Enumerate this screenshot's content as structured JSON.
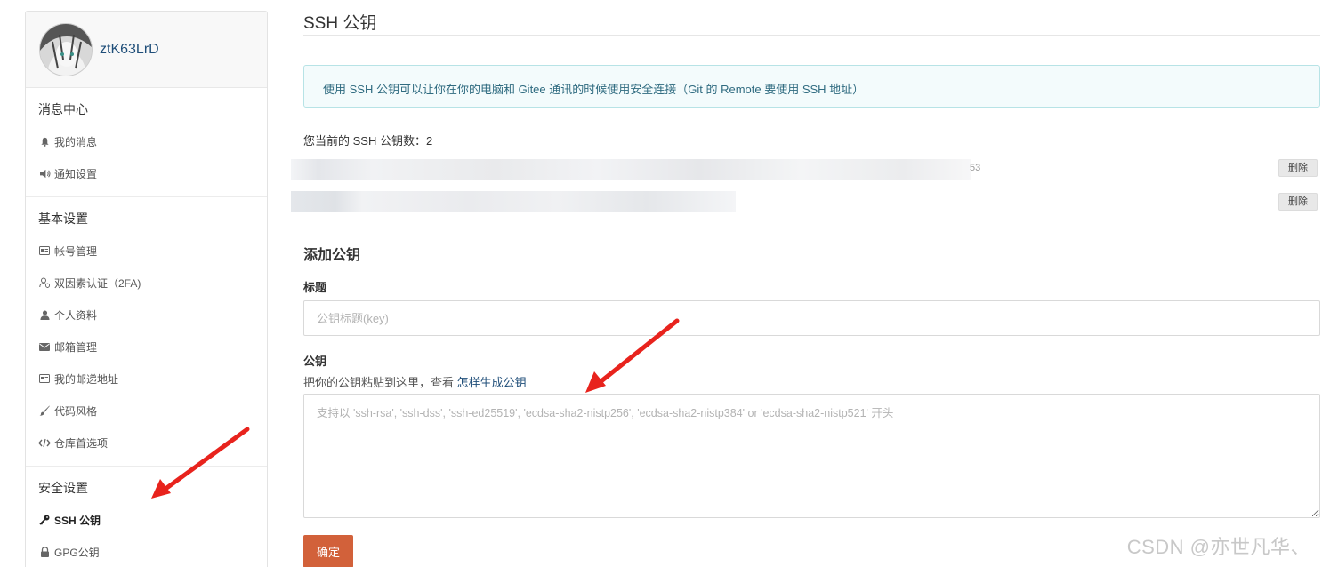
{
  "sidebar": {
    "username": "ztK63LrD",
    "sections": [
      {
        "title": "消息中心",
        "items": [
          {
            "label": "我的消息",
            "icon": "bell-icon"
          },
          {
            "label": "通知设置",
            "icon": "speaker-icon"
          }
        ]
      },
      {
        "title": "基本设置",
        "items": [
          {
            "label": "帐号管理",
            "icon": "id-card-icon"
          },
          {
            "label": "双因素认证（2FA)",
            "icon": "user-shield-icon"
          },
          {
            "label": "个人资料",
            "icon": "user-icon"
          },
          {
            "label": "邮箱管理",
            "icon": "envelope-icon"
          },
          {
            "label": "我的邮递地址",
            "icon": "address-card-icon"
          },
          {
            "label": "代码风格",
            "icon": "brush-icon"
          },
          {
            "label": "仓库首选项",
            "icon": "code-icon"
          }
        ]
      },
      {
        "title": "安全设置",
        "items": [
          {
            "label": "SSH 公钥",
            "icon": "key-icon",
            "active": true
          },
          {
            "label": "GPG公钥",
            "icon": "lock-icon"
          }
        ]
      }
    ]
  },
  "main": {
    "title": "SSH 公钥",
    "info": "使用 SSH 公钥可以让你在你的电脑和 Gitee 通讯的时候使用安全连接（Git 的 Remote 要使用 SSH 地址）",
    "count_label": "您当前的 SSH 公钥数：",
    "count_value": "2",
    "keys": [
      {
        "suffix": "53",
        "delete_label": "删除"
      },
      {
        "suffix": "",
        "delete_label": "删除"
      }
    ],
    "add_title": "添加公钥",
    "title_label": "标题",
    "title_placeholder": "公钥标题(key)",
    "key_label": "公钥",
    "key_hint": "把你的公钥粘贴到这里，查看 ",
    "key_hint_link": "怎样生成公钥",
    "key_placeholder": "支持以 'ssh-rsa', 'ssh-dss', 'ssh-ed25519', 'ecdsa-sha2-nistp256', 'ecdsa-sha2-nistp384' or 'ecdsa-sha2-nistp521' 开头",
    "confirm_label": "确定"
  },
  "watermark": "CSDN @亦世凡华、",
  "colors": {
    "accent": "#d2613a",
    "arrow": "#e8231d",
    "link": "#1f4e79",
    "info_bg": "#f3fbfc"
  }
}
